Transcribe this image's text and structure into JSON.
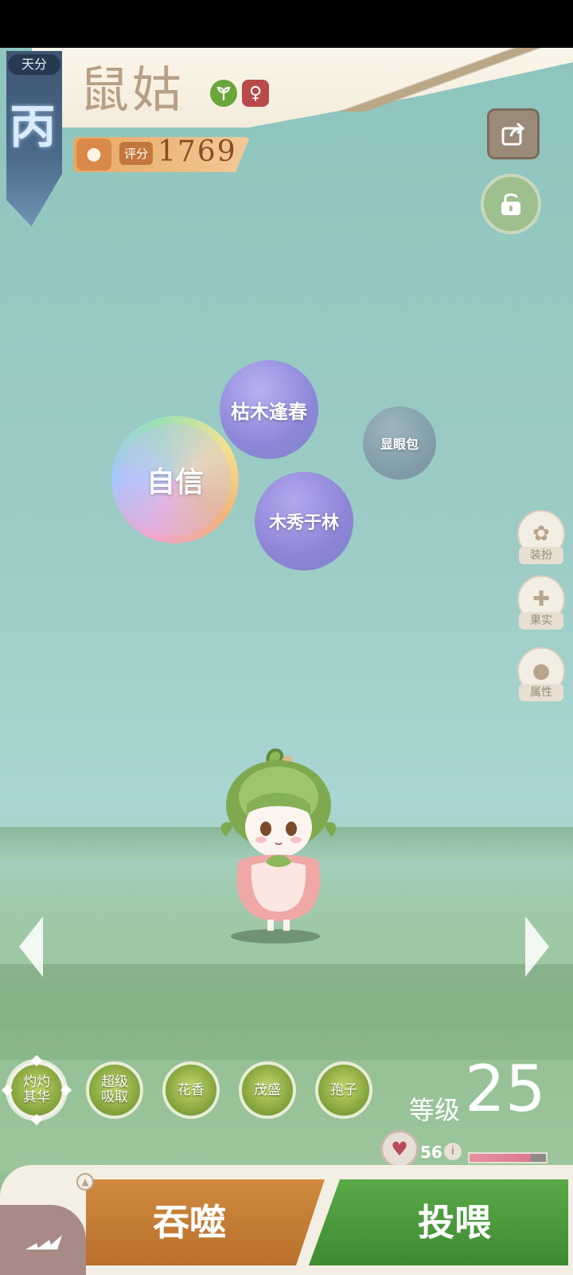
{
  "header": {
    "rank_label": "天分",
    "rank_value": "丙",
    "pet_name": "鼠姑",
    "type_icon": "plant-icon",
    "gender_symbol": "♀",
    "score_label": "评分",
    "score_value": "1769"
  },
  "bubbles": [
    "枯木逢春",
    "自信",
    "木秀于林",
    "显眼包"
  ],
  "side_menu": [
    {
      "label": "装扮",
      "icon": "butterfly-icon"
    },
    {
      "label": "果实",
      "icon": "plus-icon"
    },
    {
      "label": "属性",
      "icon": "paw-icon"
    }
  ],
  "skills": [
    {
      "label": "灼灼其华",
      "selected": true
    },
    {
      "label": "超级吸取"
    },
    {
      "label": "花香"
    },
    {
      "label": "茂盛"
    },
    {
      "label": "孢子"
    }
  ],
  "level": {
    "label": "等级",
    "value": "25"
  },
  "hp": {
    "value": "56",
    "fill_fraction": 0.8
  },
  "actions": {
    "devour_label": "吞噬",
    "feed_label": "投喂"
  }
}
